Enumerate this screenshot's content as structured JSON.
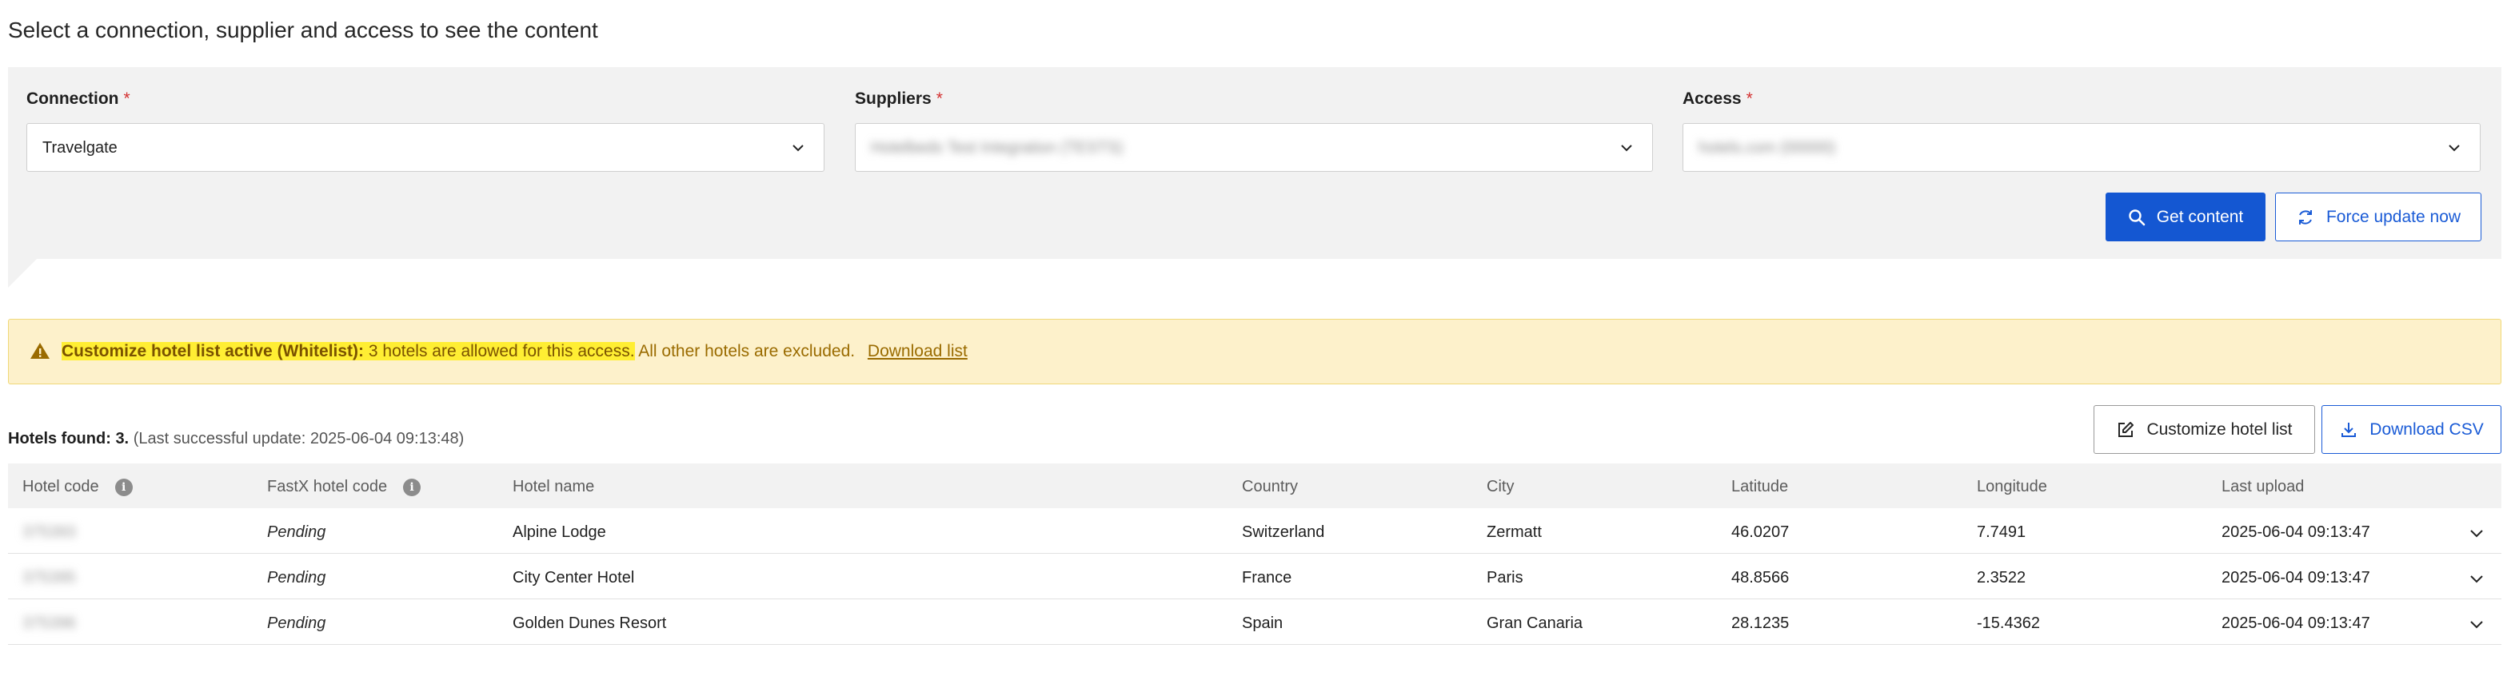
{
  "page": {
    "title": "Select a connection, supplier and access to see the content"
  },
  "filters": {
    "connection": {
      "label": "Connection",
      "required_mark": "*",
      "value": "Travelgate"
    },
    "suppliers": {
      "label": "Suppliers",
      "required_mark": "*",
      "value": "Hotelbeds Test Integration (TESTS)"
    },
    "access": {
      "label": "Access",
      "required_mark": "*",
      "value": "hotels.com (00000)"
    }
  },
  "actions": {
    "get_content": "Get content",
    "force_update": "Force update now"
  },
  "alert": {
    "title": "Customize hotel list active (Whitelist):",
    "highlight": "3 hotels are allowed for this access.",
    "rest": "All other hotels are excluded.",
    "link": "Download list"
  },
  "results": {
    "found_label": "Hotels found:",
    "found_count": "3.",
    "last_update": "(Last successful update: 2025-06-04 09:13:48)",
    "customize_button": "Customize hotel list",
    "download_csv_button": "Download CSV"
  },
  "table": {
    "columns": [
      "Hotel code",
      "FastX hotel code",
      "Hotel name",
      "Country",
      "City",
      "Latitude",
      "Longitude",
      "Last upload"
    ],
    "rows": [
      {
        "hotel_code": "375393",
        "fastx_code": "Pending",
        "name": "Alpine Lodge",
        "country": "Switzerland",
        "city": "Zermatt",
        "latitude": "46.0207",
        "longitude": "7.7491",
        "last_upload": "2025-06-04 09:13:47"
      },
      {
        "hotel_code": "375395",
        "fastx_code": "Pending",
        "name": "City Center Hotel",
        "country": "France",
        "city": "Paris",
        "latitude": "48.8566",
        "longitude": "2.3522",
        "last_upload": "2025-06-04 09:13:47"
      },
      {
        "hotel_code": "375396",
        "fastx_code": "Pending",
        "name": "Golden Dunes Resort",
        "country": "Spain",
        "city": "Gran Canaria",
        "latitude": "28.1235",
        "longitude": "-15.4362",
        "last_upload": "2025-06-04 09:13:47"
      }
    ]
  },
  "colors": {
    "primary": "#1457d2",
    "alert_bg": "#fdf1cb",
    "alert_text": "#9a6b00",
    "highlight": "#ffee33",
    "required": "#d32f2f"
  },
  "icons": {
    "select_chevron": "chevron-down-icon",
    "search": "search-icon",
    "refresh": "refresh-icon",
    "warning": "warning-icon",
    "edit": "edit-icon",
    "download": "download-icon",
    "info": "info-icon",
    "row_expand": "chevron-down-icon"
  }
}
